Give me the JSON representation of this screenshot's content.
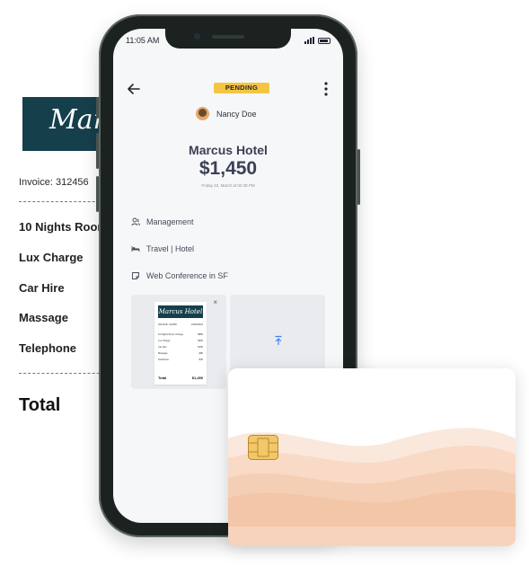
{
  "invoice": {
    "logo_text": "Marcus Hotel",
    "invoice_number": "Invoice: 312456",
    "items": [
      "10 Nights Room",
      "Lux Charge",
      "Car Hire",
      "Massage",
      "Telephone"
    ],
    "total_label": "Total"
  },
  "phone": {
    "status_time": "11:05 AM",
    "status_badge": "PENDING",
    "user_name": "Nancy Doe",
    "merchant": "Marcus Hotel",
    "amount": "$1,450",
    "date": "Friday 22, March at 02:38 PM",
    "details": [
      {
        "icon": "people-icon",
        "label": "Management"
      },
      {
        "icon": "bed-icon",
        "label": "Travel | Hotel"
      },
      {
        "icon": "note-icon",
        "label": "Web Conference in SF"
      }
    ],
    "receipt": {
      "logo_text": "Marcus Hotel",
      "header_left": "INVOICE: 312456",
      "header_right": "22/03/2024",
      "lines": [
        {
          "label": "10 Nights Room Charge",
          "value": "$880"
        },
        {
          "label": "Lux Charge",
          "value": "$300"
        },
        {
          "label": "Car Hire",
          "value": "$150"
        },
        {
          "label": "Massage",
          "value": "$80"
        },
        {
          "label": "Telephone",
          "value": "$40"
        }
      ],
      "total_label": "Total",
      "total_value": "$1,450"
    },
    "close_symbol": "×"
  },
  "colors": {
    "badge": "#f4c542",
    "logo_bg": "#163f4c",
    "amount_text": "#3b4055",
    "upload_accent": "#3b82f6",
    "card_waves": [
      "#fbe8dc",
      "#f8dac6",
      "#f5cfb5",
      "#f2c6a7"
    ]
  }
}
